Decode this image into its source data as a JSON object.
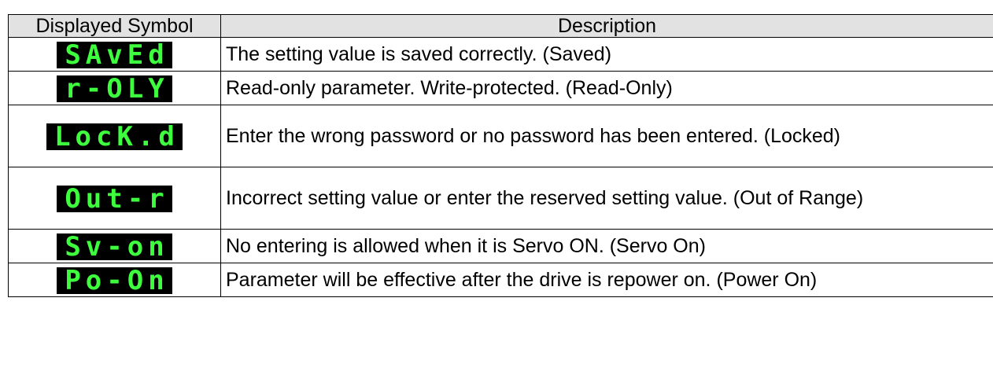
{
  "table": {
    "header": {
      "symbol": "Displayed Symbol",
      "description": "Description"
    },
    "rows": [
      {
        "symbol": "SAvEd",
        "description": "The setting value is saved correctly. (Saved)"
      },
      {
        "symbol": "r-OLY",
        "description": "Read-only parameter. Write-protected. (Read-Only)"
      },
      {
        "symbol": "LocK.d",
        "description": "Enter the wrong password or no password has been entered. (Locked)"
      },
      {
        "symbol": "Out-r",
        "description": "Incorrect setting value or enter the reserved setting value. (Out of Range)"
      },
      {
        "symbol": "Sv-on",
        "description": "No entering is allowed when it is Servo ON. (Servo On)"
      },
      {
        "symbol": "Po-On",
        "description": "Parameter will be effective after the drive is repower on. (Power On)"
      }
    ]
  },
  "colors": {
    "display_bg": "#000000",
    "display_fg": "#3dff3d",
    "header_bg": "#e2e2e2"
  }
}
